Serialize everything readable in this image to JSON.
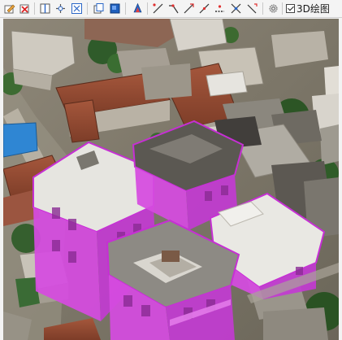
{
  "toolbar": {
    "buttons": [
      {
        "name": "edit-geometry-icon"
      },
      {
        "name": "delete-feature-icon"
      },
      {
        "name": "split-icon"
      },
      {
        "name": "merge-icon"
      },
      {
        "name": "zoom-extent-icon"
      },
      {
        "name": "layer-copy-icon"
      },
      {
        "name": "fill-layer-icon"
      },
      {
        "name": "flip-icon"
      },
      {
        "name": "draw-line-icon"
      },
      {
        "name": "draw-polyline-icon"
      },
      {
        "name": "draw-arc-icon"
      },
      {
        "name": "draw-segment-icon"
      },
      {
        "name": "draw-dash-icon"
      },
      {
        "name": "cross-node-icon"
      },
      {
        "name": "measure-icon"
      },
      {
        "name": "settings-icon"
      },
      {
        "name": "snap-icon"
      }
    ],
    "toggle_3d": {
      "label": "3D绘图",
      "checked": true
    }
  },
  "colors": {
    "selection_fill": "#d645e0",
    "selection_stroke": "#b81fc8",
    "roof": "#e7e6e1"
  }
}
